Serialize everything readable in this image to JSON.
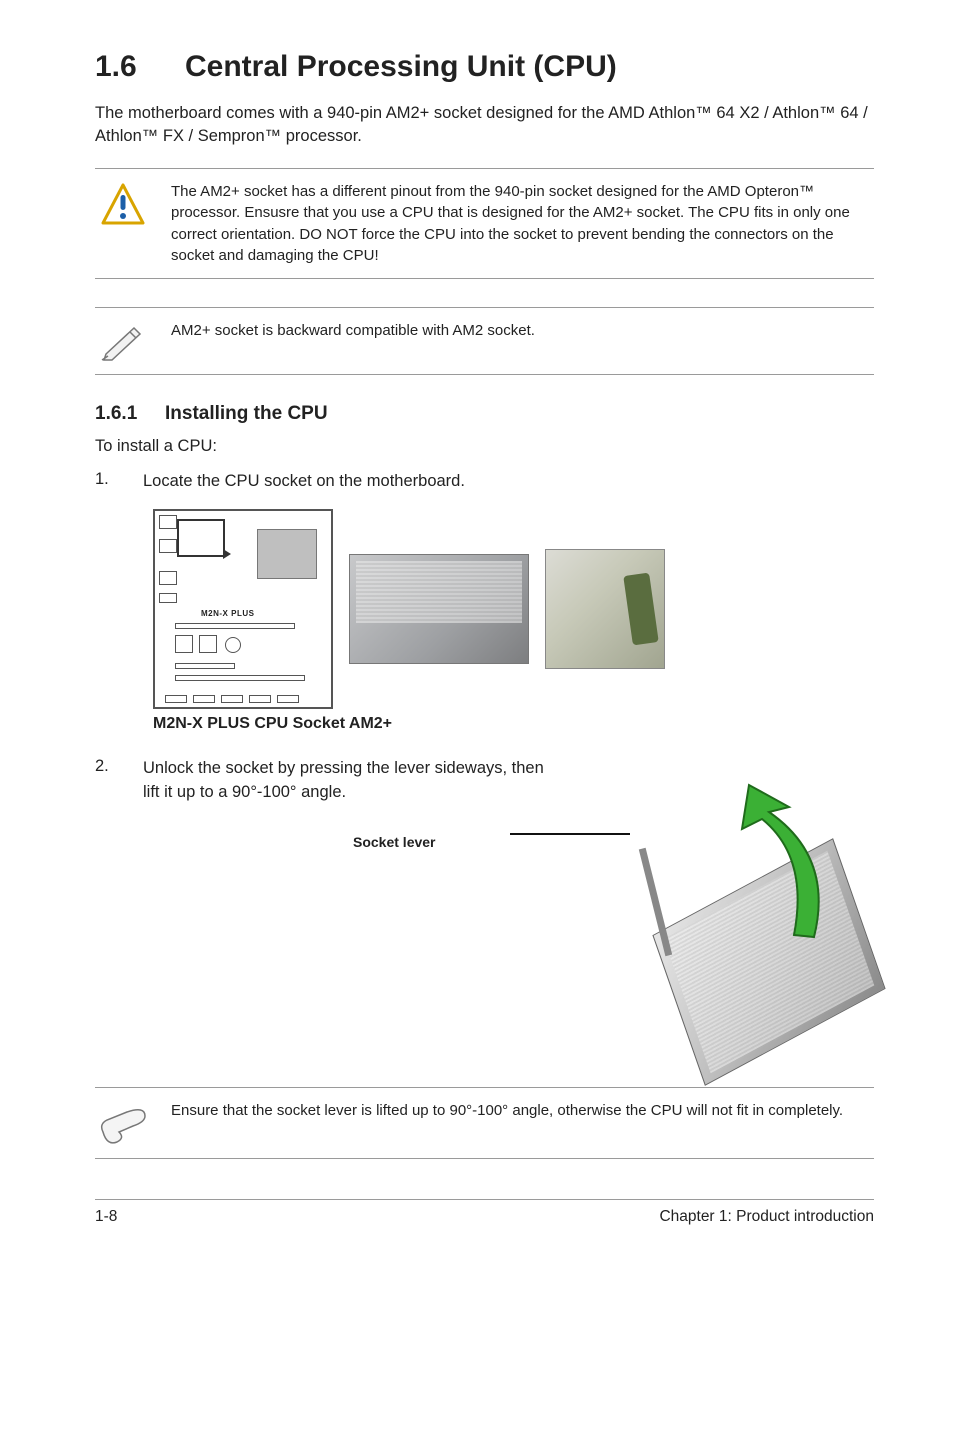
{
  "section": {
    "number": "1.6",
    "title": "Central Processing Unit (CPU)"
  },
  "intro": "The motherboard comes with a 940-pin AM2+ socket designed for the AMD Athlon™ 64 X2 / Athlon™ 64 / Athlon™ FX / Sempron™ processor.",
  "callout_warning": "The AM2+ socket has a different pinout from the 940-pin socket designed for the AMD Opteron™ processor. Ensusre that you use a CPU that is designed for the AM2+ socket. The CPU fits in only one correct orientation. DO NOT force the CPU into the socket to prevent bending the connectors on the socket and damaging the CPU!",
  "callout_note": "AM2+ socket is backward compatible with AM2 socket.",
  "subsection": {
    "number": "1.6.1",
    "title": "Installing the CPU"
  },
  "install_lead": "To install a CPU:",
  "steps": {
    "s1_num": "1.",
    "s1_text": "Locate the CPU socket on the motherboard.",
    "s2_num": "2.",
    "s2_text": "Unlock the socket by pressing the lever sideways, then lift it up to a 90°-100° angle."
  },
  "diagram": {
    "board_label": "M2N-X PLUS",
    "caption": "M2N-X PLUS CPU Socket AM2+"
  },
  "socket_lever_label": "Socket lever",
  "callout_hand": "Ensure that the socket lever is lifted up to 90°-100° angle, otherwise the CPU will not fit in completely.",
  "footer": {
    "page": "1-8",
    "chapter": "Chapter 1: Product introduction"
  }
}
